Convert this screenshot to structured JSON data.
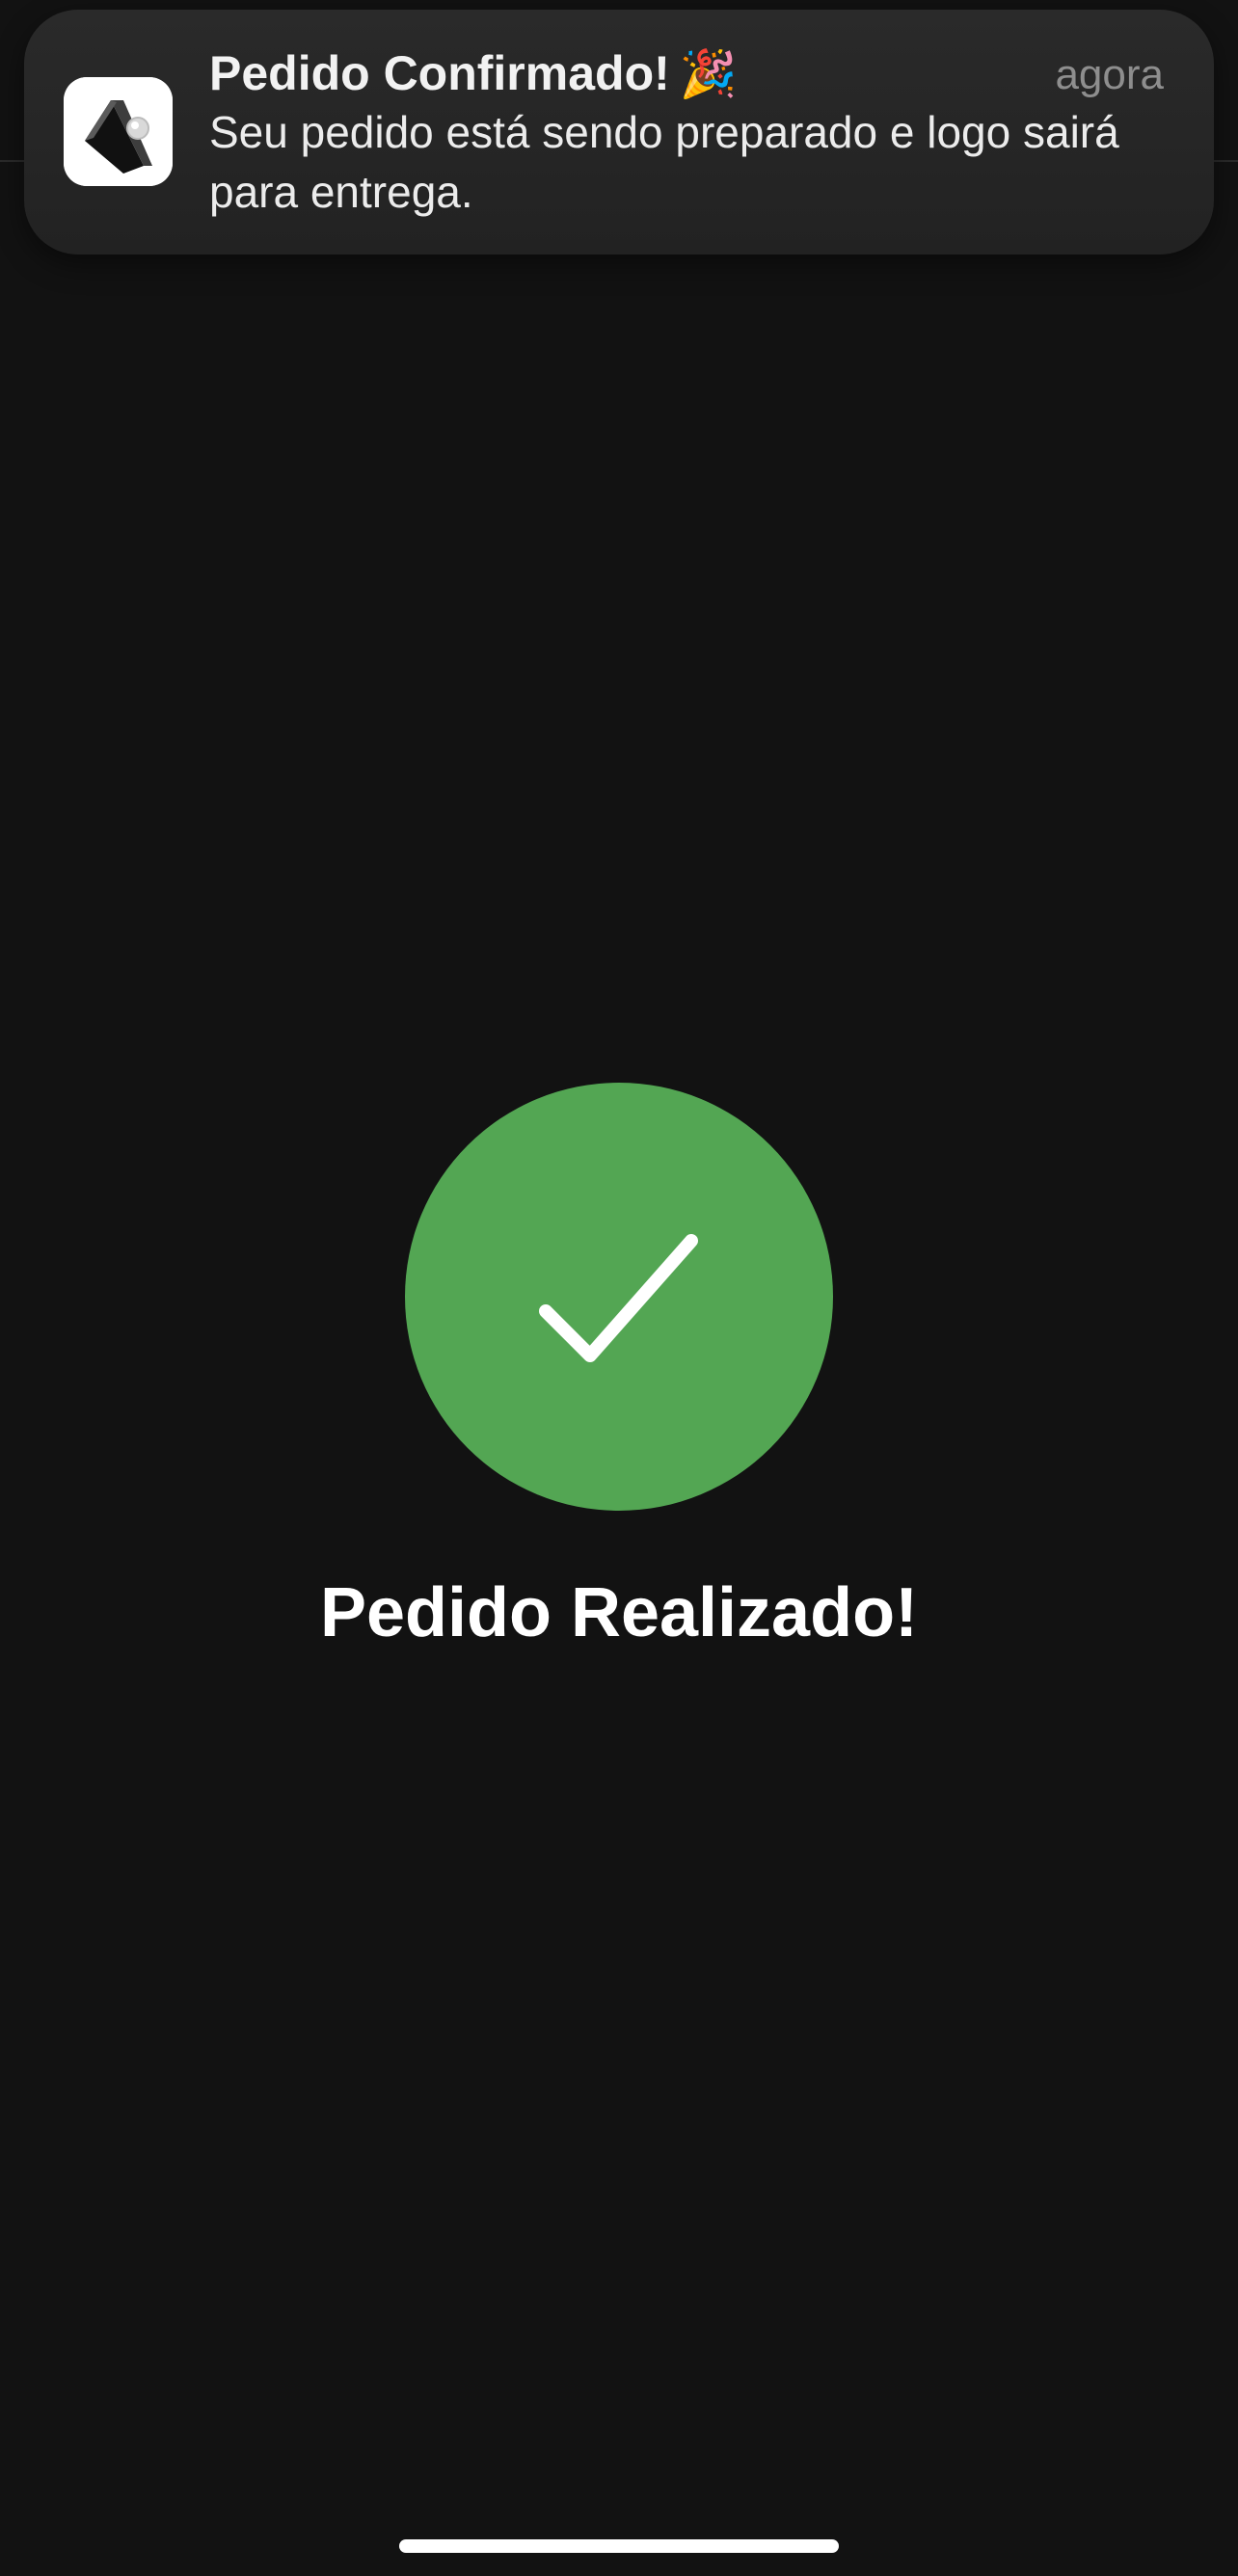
{
  "notification": {
    "app_icon": "app-logo-icon",
    "title": "Pedido Confirmado!",
    "title_emoji": "🎉",
    "time": "agora",
    "body": "Seu pedido está sendo preparado e logo sairá para entrega."
  },
  "success": {
    "icon": "checkmark-icon",
    "color": "#53a653",
    "title": "Pedido Realizado!"
  },
  "colors": {
    "background": "#121212",
    "notification_background": "#262626"
  }
}
